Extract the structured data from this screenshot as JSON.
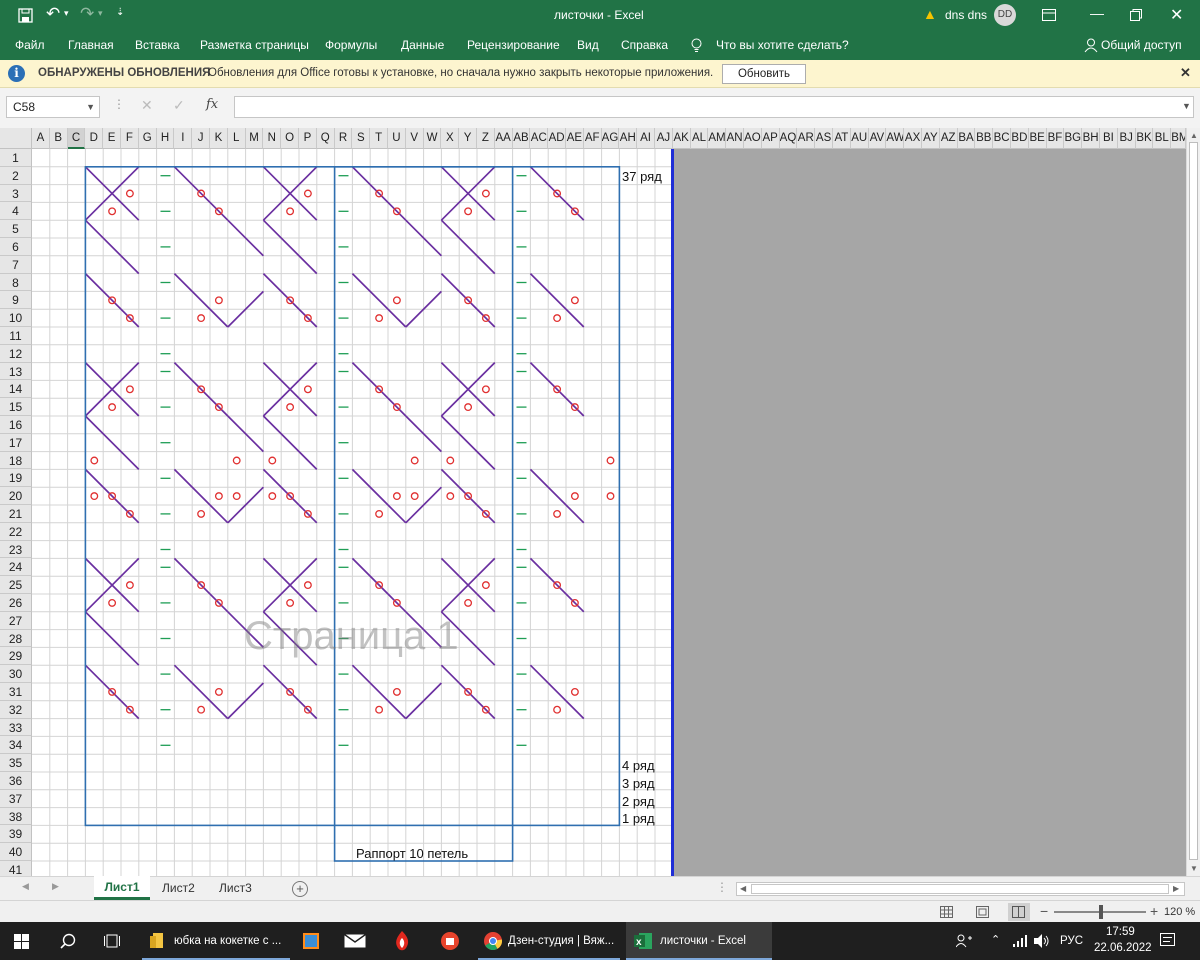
{
  "window": {
    "title": "листочки  -  Excel",
    "user": "dns dns",
    "user_initials": "DD"
  },
  "ribbon": {
    "tabs": [
      "Файл",
      "Главная",
      "Вставка",
      "Разметка страницы",
      "Формулы",
      "Данные",
      "Рецензирование",
      "Вид",
      "Справка"
    ],
    "tell_me": "Что вы хотите сделать?",
    "share": "Общий доступ"
  },
  "infobar": {
    "title": "ОБНАРУЖЕНЫ ОБНОВЛЕНИЯ",
    "message": "Обновления для Office готовы к установке, но сначала нужно закрыть некоторые приложения.",
    "button": "Обновить"
  },
  "formula_bar": {
    "name_box": "C58",
    "fx": "fx",
    "value": ""
  },
  "grid": {
    "columns": [
      "A",
      "B",
      "C",
      "D",
      "E",
      "F",
      "G",
      "H",
      "I",
      "J",
      "K",
      "L",
      "M",
      "N",
      "O",
      "P",
      "Q",
      "R",
      "S",
      "T",
      "U",
      "V",
      "W",
      "X",
      "Y",
      "Z",
      "AA",
      "AB",
      "AC",
      "AD",
      "AE",
      "AF",
      "AG",
      "AH",
      "AI",
      "AJ",
      "AK",
      "AL",
      "AM",
      "AN",
      "AO",
      "AP",
      "AQ",
      "AR",
      "AS",
      "AT",
      "AU",
      "AV",
      "AW",
      "AX",
      "AY",
      "AZ",
      "BA",
      "BB",
      "BC",
      "BD",
      "BE",
      "BF",
      "BG",
      "BH",
      "BI",
      "BJ",
      "BK",
      "BL",
      "BM"
    ],
    "rows": [
      "1",
      "2",
      "3",
      "4",
      "5",
      "6",
      "7",
      "8",
      "9",
      "10",
      "11",
      "12",
      "13",
      "14",
      "15",
      "16",
      "17",
      "18",
      "19",
      "20",
      "21",
      "22",
      "23",
      "24",
      "25",
      "26",
      "27",
      "28",
      "29",
      "30",
      "31",
      "32",
      "33",
      "34",
      "35",
      "36",
      "37",
      "38",
      "39",
      "40",
      "41"
    ],
    "page_watermark": "Страница 1",
    "labels": {
      "row37": "37 ряд",
      "row4": "4 ряд",
      "row3": "3 ряд",
      "row2": "2 ряд",
      "row1": "1 ряд",
      "rapport": "Раппорт 10 петель"
    }
  },
  "sheet_tabs": [
    "Лист1",
    "Лист2",
    "Лист3"
  ],
  "status": {
    "zoom": "120 %"
  },
  "taskbar": {
    "items": [
      "юбка на кокетке с ...",
      "Дзен-студия | Вяж...",
      "листочки - Excel"
    ],
    "lang": "РУС",
    "time": "17:59",
    "date": "22.06.2022"
  },
  "colors": {
    "excel_green": "#217346",
    "yo": "#e03030",
    "purl": "#1f9e55",
    "decrease": "#6a2fa0",
    "frame": "#2f6fb0"
  }
}
